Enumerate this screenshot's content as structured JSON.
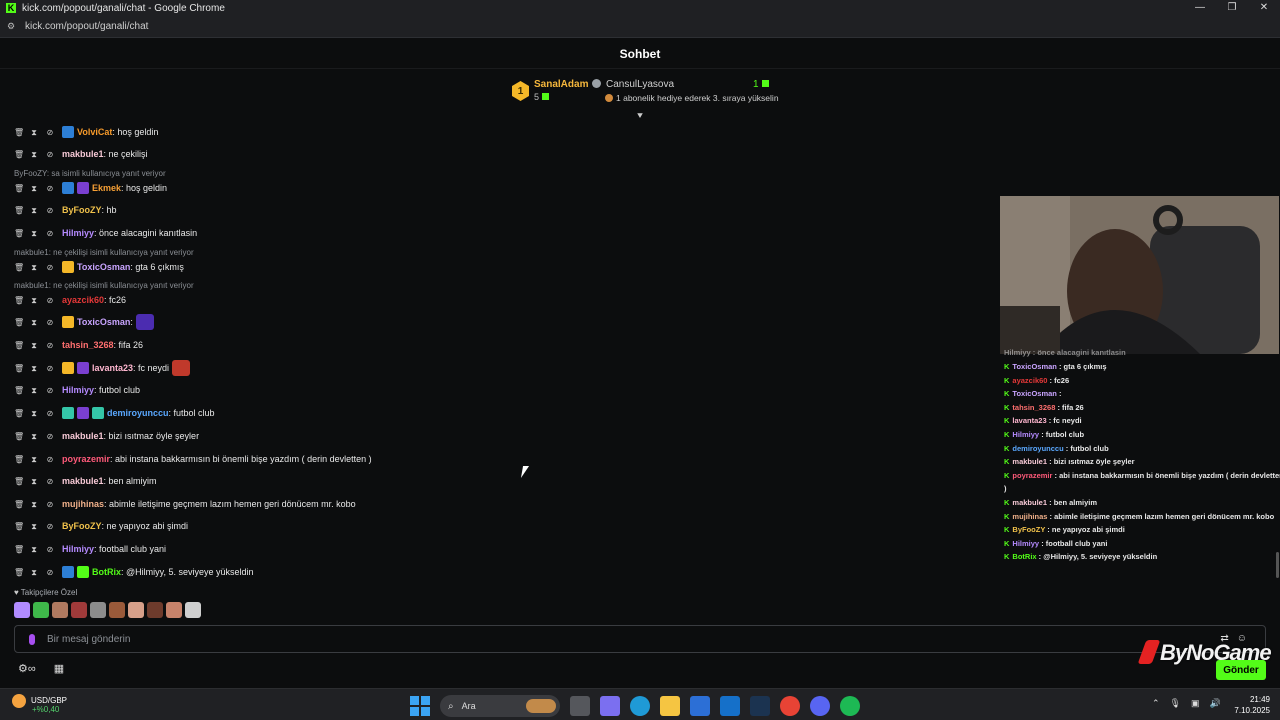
{
  "window": {
    "title": "kick.com/popout/ganali/chat - Google Chrome",
    "url": "kick.com/popout/ganali/chat",
    "controls": [
      "—",
      "❐",
      "✕"
    ]
  },
  "chat": {
    "header": "Sohbet",
    "leaderboard": {
      "first": {
        "rank": "1",
        "name": "SanalAdam",
        "count": "5"
      },
      "second": {
        "name": "CansulLyasova",
        "count": "1",
        "desc": "1 abonelik hediye ederek 3. sıraya yükselin"
      }
    },
    "messages": [
      {
        "user": "VolviCat",
        "color": "#f79a2a",
        "text": ": hoş geldin"
      },
      {
        "user": "makbule1",
        "color": "#f7c9d6",
        "text": ": ne çekilişi"
      },
      {
        "reply": "ByFooZY: sa isimli kullanıcıya yanıt veriyor"
      },
      {
        "user": "Ekmek",
        "color": "#f7a035",
        "text": ": hoş geldin"
      },
      {
        "user": "ByFooZY",
        "color": "#f0c14b",
        "text": ": hb"
      },
      {
        "user": "Hilmiyy",
        "color": "#b58bff",
        "text": ": önce alacagini kanıtlasin"
      },
      {
        "reply": "makbule1: ne çekilişi isimli kullanıcıya yanıt veriyor"
      },
      {
        "user": "ToxicOsman",
        "color": "#c9a4ff",
        "text": ": gta 6 çıkmış"
      },
      {
        "reply": "makbule1: ne çekilişi isimli kullanıcıya yanıt veriyor"
      },
      {
        "user": "ayazcik60",
        "color": "#e43838",
        "text": ": fc26"
      },
      {
        "user": "ToxicOsman",
        "color": "#c9a4ff",
        "text": ":"
      },
      {
        "user": "tahsin_3268",
        "color": "#ff6f6f",
        "text": ": fifa 26"
      },
      {
        "user": "lavanta23",
        "color": "#ffb7d0",
        "text": ": fc neydi"
      },
      {
        "user": "Hilmiyy",
        "color": "#b58bff",
        "text": ": futbol club"
      },
      {
        "user": "demiroyunccu",
        "color": "#5aa8ff",
        "text": ": futbol club"
      },
      {
        "user": "makbule1",
        "color": "#f7c9d6",
        "text": ": bizi ısıtmaz öyle şeyler"
      },
      {
        "user": "poyrazemir",
        "color": "#ff5a7a",
        "text": ": abi instana bakkarmısın bi önemli bişe yazdım ( derin devletten )"
      },
      {
        "user": "makbule1",
        "color": "#f7c9d6",
        "text": ": ben almiyim"
      },
      {
        "user": "mujihinas",
        "color": "#f0b08a",
        "text": ": abimle iletişime geçmem lazım hemen geri dönücem mr. kobo"
      },
      {
        "user": "ByFooZY",
        "color": "#f0c14b",
        "text": ": ne yapıyoz abi şimdi"
      },
      {
        "user": "Hilmiyy",
        "color": "#b58bff",
        "text": ": football club yani"
      },
      {
        "user": "BotRix",
        "color": "#53fc18",
        "text": ": @Hilmiyy, 5. seviyeye yükseldin"
      }
    ],
    "followers_label": "Takipçilere Özel",
    "input_placeholder": "Bir mesaj gönderin",
    "send_label": "Gönder"
  },
  "overlay": {
    "partial_top": "Hilmiyy : önce alacagini kanıtlasin",
    "lines": [
      {
        "user": "ToxicOsman",
        "color": "#c9a4ff",
        "text": " : gta 6 çıkmış"
      },
      {
        "user": "ayazcik60",
        "color": "#e43838",
        "text": " : fc26"
      },
      {
        "user": "ToxicOsman",
        "color": "#c9a4ff",
        "text": " :"
      },
      {
        "user": "tahsin_3268",
        "color": "#ff6f6f",
        "text": " : fifa 26"
      },
      {
        "user": "lavanta23",
        "color": "#ffb7d0",
        "text": " : fc neydi"
      },
      {
        "user": "Hilmiyy",
        "color": "#b58bff",
        "text": " : futbol club"
      },
      {
        "user": "demiroyunccu",
        "color": "#5aa8ff",
        "text": " : futbol club"
      },
      {
        "user": "makbule1",
        "color": "#f7c9d6",
        "text": " : bizi ısıtmaz öyle şeyler"
      },
      {
        "user": "poyrazemir",
        "color": "#ff5a7a",
        "text": " : abi instana bakkarmısın bi önemli bişe yazdım ( derin devletten"
      },
      {
        "user": "",
        "color": "#e8e8e8",
        "text": ")"
      },
      {
        "user": "makbule1",
        "color": "#f7c9d6",
        "text": " : ben almiyim"
      },
      {
        "user": "mujihinas",
        "color": "#f0b08a",
        "text": " : abimle iletişime geçmem lazım hemen geri dönücem mr. kobo"
      },
      {
        "user": "ByFooZY",
        "color": "#f0c14b",
        "text": " : ne yapıyoz abi şimdi"
      },
      {
        "user": "Hilmiyy",
        "color": "#b58bff",
        "text": " : football club yani"
      },
      {
        "user": "BotRix",
        "color": "#53fc18",
        "text": " : @Hilmiyy, 5. seviyeye yükseldin"
      }
    ],
    "brand": "ByNoGame"
  },
  "taskbar": {
    "ticker_label": "USD/GBP",
    "ticker_change": "+%0,40",
    "search_placeholder": "Ara",
    "time": "21:49",
    "date": "7.10.2025"
  }
}
